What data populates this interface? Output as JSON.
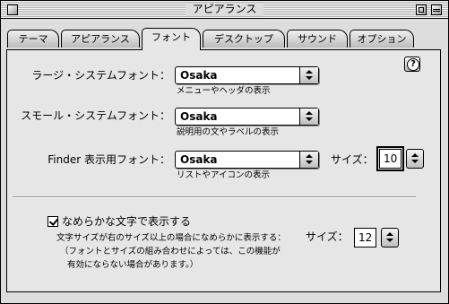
{
  "window": {
    "title": "アピアランス"
  },
  "tabs": [
    {
      "label": "テーマ",
      "active": false
    },
    {
      "label": "アピアランス",
      "active": false
    },
    {
      "label": "フォント",
      "active": true
    },
    {
      "label": "デスクトップ",
      "active": false
    },
    {
      "label": "サウンド",
      "active": false
    },
    {
      "label": "オプション",
      "active": false
    }
  ],
  "help": {
    "glyph": "?"
  },
  "fonts": {
    "large": {
      "label": "ラージ・システムフォント：",
      "value": "Osaka",
      "note": "メニューやヘッダの表示"
    },
    "small": {
      "label": "スモール・システムフォント：",
      "value": "Osaka",
      "note": "説明用の文やラベルの表示"
    },
    "finder": {
      "label": "Finder 表示用フォント：",
      "value": "Osaka",
      "note": "リストやアイコンの表示",
      "size_label": "サイズ：",
      "size_value": "10"
    }
  },
  "smoothing": {
    "checkbox_label": "なめらかな文字で表示する",
    "checked": true,
    "desc_line1": "文字サイズが右のサイズ以上の場合になめらかに表示する：",
    "desc_line2": "（フォントとサイズの組み合わせによっては、この機能が",
    "desc_line3": "有効にならない場合があります。）",
    "size_label": "サイズ：",
    "size_value": "12"
  }
}
